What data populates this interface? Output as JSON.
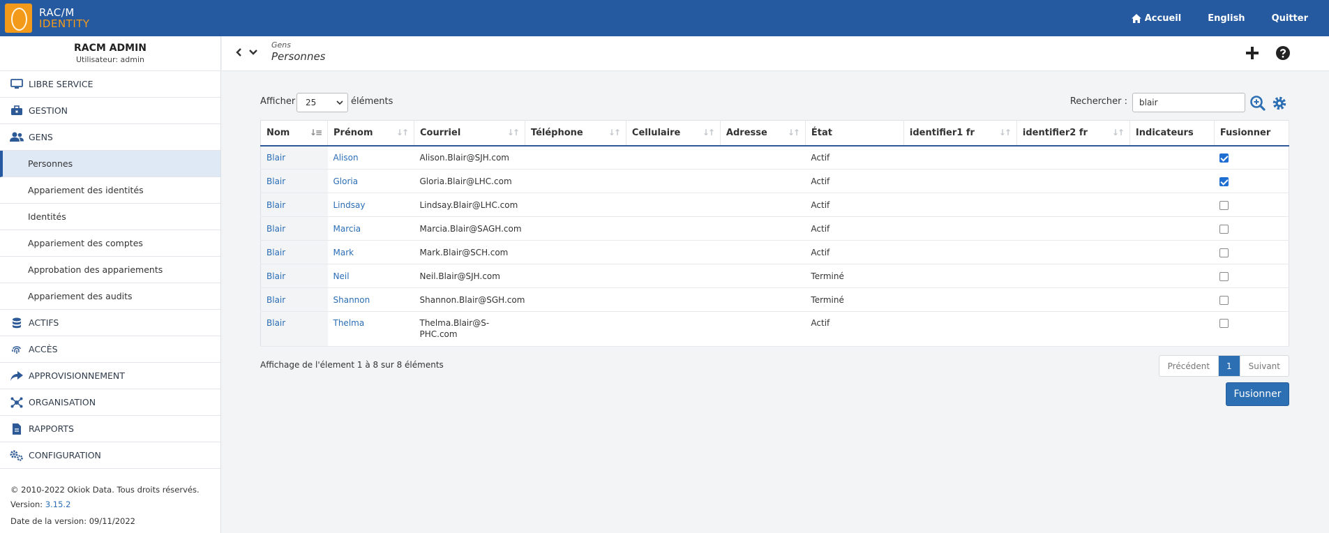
{
  "brand": {
    "line1": "RAC/M",
    "line2": "IDENTITY"
  },
  "topnav": {
    "home": "Accueil",
    "language": "English",
    "quit": "Quitter"
  },
  "sidebar": {
    "title": "RACM ADMIN",
    "user": "Utilisateur: admin",
    "sections": {
      "libre": "LIBRE SERVICE",
      "gestion": "GESTION",
      "gens": "GENS",
      "actifs": "ACTIFS",
      "acces": "ACCÈS",
      "appro": "APPROVISIONNEMENT",
      "org": "ORGANISATION",
      "rapports": "RAPPORTS",
      "config": "CONFIGURATION"
    },
    "gens_items": [
      "Personnes",
      "Appariement des identités",
      "Identités",
      "Appariement des comptes",
      "Approbation des appariements",
      "Appariement des audits"
    ],
    "footer": {
      "copyright": "© 2010-2022 Okiok Data. Tous droits réservés.",
      "version_label": "Version:",
      "version": "3.15.2",
      "date": "Date de la version: 09/11/2022"
    }
  },
  "header": {
    "crumb_parent": "Gens",
    "crumb_current": "Personnes"
  },
  "controls": {
    "show_label": "Afficher",
    "page_size": "25",
    "show_suffix": "éléments",
    "search_label": "Rechercher :",
    "search_value": "blair"
  },
  "table": {
    "columns": [
      "Nom",
      "Prénom",
      "Courriel",
      "Téléphone",
      "Cellulaire",
      "Adresse",
      "État",
      "identifier1 fr",
      "identifier2 fr",
      "Indicateurs",
      "Fusionner"
    ],
    "rows": [
      {
        "nom": "Blair",
        "prenom": "Alison",
        "courriel": "Alison.Blair@SJH.com",
        "etat": "Actif",
        "merge": true
      },
      {
        "nom": "Blair",
        "prenom": "Gloria",
        "courriel": "Gloria.Blair@LHC.com",
        "etat": "Actif",
        "merge": true
      },
      {
        "nom": "Blair",
        "prenom": "Lindsay",
        "courriel": "Lindsay.Blair@LHC.com",
        "etat": "Actif",
        "merge": false
      },
      {
        "nom": "Blair",
        "prenom": "Marcia",
        "courriel": "Marcia.Blair@SAGH.com",
        "etat": "Actif",
        "merge": false
      },
      {
        "nom": "Blair",
        "prenom": "Mark",
        "courriel": "Mark.Blair@SCH.com",
        "etat": "Actif",
        "merge": false
      },
      {
        "nom": "Blair",
        "prenom": "Neil",
        "courriel": "Neil.Blair@SJH.com",
        "etat": "Terminé",
        "merge": false
      },
      {
        "nom": "Blair",
        "prenom": "Shannon",
        "courriel": "Shannon.Blair@SGH.com",
        "etat": "Terminé",
        "merge": false
      },
      {
        "nom": "Blair",
        "prenom": "Thelma",
        "courriel_line1": "Thelma.Blair@S-",
        "courriel_line2": "PHC.com",
        "etat": "Actif",
        "merge": false
      }
    ]
  },
  "footer": {
    "info": "Affichage de l'élement 1 à 8 sur 8 éléments",
    "prev": "Précédent",
    "page": "1",
    "next": "Suivant",
    "merge_button": "Fusionner"
  },
  "colors": {
    "primary": "#255aa0",
    "accent": "#f39a1b",
    "link": "#2a6db5"
  }
}
